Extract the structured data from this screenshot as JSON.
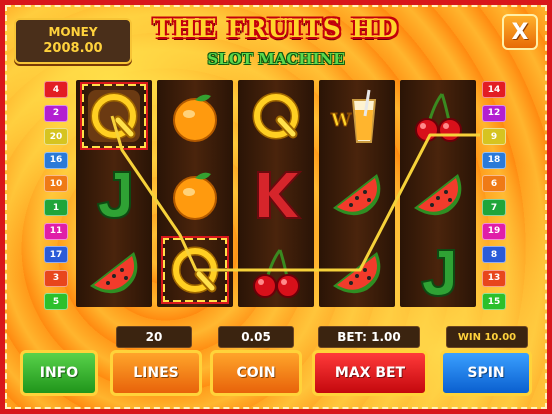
{
  "header": {
    "money_label": "MONEY",
    "money_value": "2008.00",
    "title": "THE FRUITS HD",
    "subtitle": "SLOT MACHINE",
    "close_label": "X"
  },
  "left_lines": [
    "4",
    "2",
    "20",
    "16",
    "10",
    "1",
    "11",
    "17",
    "3",
    "5"
  ],
  "right_lines": [
    "14",
    "12",
    "9",
    "18",
    "6",
    "7",
    "19",
    "8",
    "13",
    "15"
  ],
  "reels": [
    [
      "Q",
      "J",
      "watermelon"
    ],
    [
      "orange",
      "orange",
      "Q"
    ],
    [
      "Q",
      "K",
      "cherry"
    ],
    [
      "W",
      "watermelon",
      "watermelon"
    ],
    [
      "cherry",
      "watermelon",
      "J"
    ]
  ],
  "controls": {
    "lines_value": "20",
    "coin_value": "0.05",
    "bet_value": "BET: 1.00",
    "win_value": "WIN 10.00",
    "info_label": "INFO",
    "lines_label": "LINES",
    "coin_label": "COIN",
    "max_bet_label": "MAX BET",
    "spin_label": "SPIN"
  },
  "colors": {
    "frame_red": "#d8171b",
    "title_yellow": "#ffd42a",
    "subtitle_green": "#5cd84c",
    "badge_colors": [
      "#e31c23",
      "#b31fd1",
      "#d6c420",
      "#2a7ad8",
      "#ef7a16",
      "#1fa53a",
      "#e01ea8",
      "#2a5bd8",
      "#e8461c",
      "#2bc02b"
    ]
  }
}
